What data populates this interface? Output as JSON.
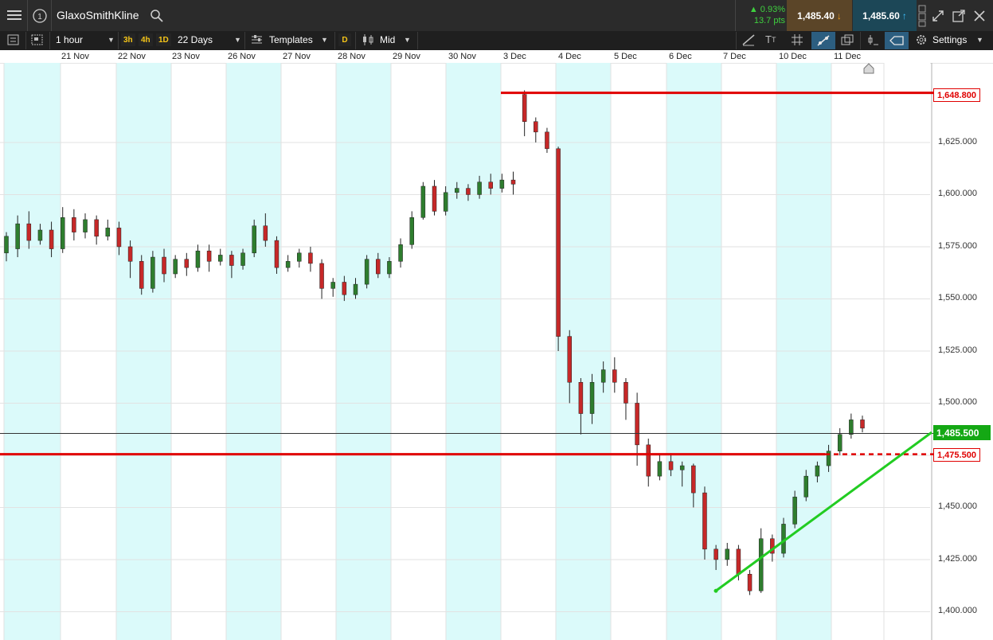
{
  "instrument": "GlaxoSmithKline",
  "change": {
    "percent": "0.93%",
    "points": "13.7 pts"
  },
  "prices": {
    "sell": "1,485.40",
    "buy": "1,485.60"
  },
  "toolbar": {
    "interval": "1 hour",
    "quick_intervals": [
      "3h",
      "4h",
      "1D"
    ],
    "range": "22 Days",
    "templates": "Templates",
    "d_badge": "D",
    "price_type": "Mid",
    "settings": "Settings"
  },
  "icons": [
    "menu-icon",
    "info-icon",
    "search-icon",
    "list-icon",
    "layout-icon",
    "templates-icon",
    "candle-type-icon",
    "draw-line-icon",
    "text-icon",
    "crosshair-icon",
    "trendline-icon",
    "windows-icon",
    "indicator-icon",
    "price-tag-icon",
    "gear-icon",
    "expand-icon",
    "popout-icon",
    "close-icon",
    "arrow-down-icon",
    "arrow-up-icon"
  ],
  "colors": {
    "up": "#2e7d2e",
    "down": "#c62828",
    "support_line": "#e00000",
    "trend_line": "#22cc22",
    "weekend_shade": "#dbfafa",
    "last_price_bg": "#14a814"
  },
  "date_labels": [
    "21 Nov",
    "22 Nov",
    "23 Nov",
    "26 Nov",
    "27 Nov",
    "28 Nov",
    "29 Nov",
    "30 Nov",
    "3 Dec",
    "4 Dec",
    "5 Dec",
    "6 Dec",
    "7 Dec",
    "10 Dec",
    "11 Dec"
  ],
  "y_ticks": [
    "1,625.000",
    "1,600.000",
    "1,575.000",
    "1,550.000",
    "1,525.000",
    "1,500.000",
    "1,450.000",
    "1,425.000",
    "1,400.000"
  ],
  "price_labels": {
    "resistance": "1,648.800",
    "last": "1,485.500",
    "support": "1,475.500"
  },
  "chart_data": {
    "type": "candlestick",
    "interval": "1 hour",
    "y_range": [
      1395,
      1665
    ],
    "levels": {
      "resistance": 1648.8,
      "last_price": 1485.5,
      "support": 1475.5
    },
    "trendline": {
      "from": {
        "date": "7 Dec",
        "price": 1410
      },
      "to": {
        "date": "11 Dec",
        "price": 1486
      }
    },
    "candles": [
      [
        1572,
        1580,
        1568,
        1582
      ],
      [
        1574,
        1586,
        1570,
        1590
      ],
      [
        1586,
        1578,
        1574,
        1592
      ],
      [
        1578,
        1583,
        1576,
        1586
      ],
      [
        1583,
        1574,
        1570,
        1587
      ],
      [
        1574,
        1589,
        1572,
        1594
      ],
      [
        1589,
        1582,
        1578,
        1593
      ],
      [
        1582,
        1588,
        1579,
        1591
      ],
      [
        1588,
        1580,
        1576,
        1590
      ],
      [
        1580,
        1584,
        1578,
        1588
      ],
      [
        1584,
        1575,
        1571,
        1587
      ],
      [
        1575,
        1568,
        1560,
        1578
      ],
      [
        1568,
        1555,
        1552,
        1571
      ],
      [
        1555,
        1570,
        1553,
        1573
      ],
      [
        1570,
        1562,
        1558,
        1574
      ],
      [
        1562,
        1569,
        1560,
        1571
      ],
      [
        1569,
        1565,
        1561,
        1572
      ],
      [
        1565,
        1573,
        1563,
        1576
      ],
      [
        1573,
        1568,
        1563,
        1576
      ],
      [
        1568,
        1571,
        1566,
        1574
      ],
      [
        1571,
        1566,
        1560,
        1573
      ],
      [
        1566,
        1572,
        1564,
        1574
      ],
      [
        1572,
        1585,
        1570,
        1588
      ],
      [
        1585,
        1578,
        1575,
        1591
      ],
      [
        1578,
        1565,
        1562,
        1580
      ],
      [
        1565,
        1568,
        1563,
        1571
      ],
      [
        1568,
        1572,
        1565,
        1574
      ],
      [
        1572,
        1567,
        1563,
        1575
      ],
      [
        1567,
        1555,
        1550,
        1569
      ],
      [
        1555,
        1558,
        1551,
        1560
      ],
      [
        1558,
        1552,
        1549,
        1561
      ],
      [
        1552,
        1557,
        1550,
        1560
      ],
      [
        1557,
        1569,
        1555,
        1571
      ],
      [
        1569,
        1562,
        1560,
        1572
      ],
      [
        1562,
        1568,
        1560,
        1570
      ],
      [
        1568,
        1576,
        1565,
        1579
      ],
      [
        1576,
        1589,
        1574,
        1592
      ],
      [
        1589,
        1604,
        1588,
        1606
      ],
      [
        1604,
        1592,
        1590,
        1607
      ],
      [
        1592,
        1601,
        1590,
        1604
      ],
      [
        1601,
        1603,
        1598,
        1606
      ],
      [
        1603,
        1600,
        1597,
        1605
      ],
      [
        1600,
        1606,
        1598,
        1609
      ],
      [
        1606,
        1603,
        1600,
        1610
      ],
      [
        1603,
        1607,
        1601,
        1610
      ],
      [
        1607,
        1605,
        1600,
        1611
      ],
      [
        1648,
        1635,
        1628,
        1650
      ],
      [
        1635,
        1630,
        1625,
        1637
      ],
      [
        1630,
        1622,
        1620,
        1632
      ],
      [
        1622,
        1532,
        1525,
        1623
      ],
      [
        1532,
        1510,
        1500,
        1535
      ],
      [
        1510,
        1495,
        1485,
        1512
      ],
      [
        1495,
        1510,
        1490,
        1514
      ],
      [
        1510,
        1516,
        1505,
        1520
      ],
      [
        1516,
        1510,
        1505,
        1522
      ],
      [
        1510,
        1500,
        1492,
        1512
      ],
      [
        1500,
        1480,
        1470,
        1505
      ],
      [
        1480,
        1465,
        1460,
        1483
      ],
      [
        1465,
        1472,
        1463,
        1475
      ],
      [
        1472,
        1468,
        1465,
        1476
      ],
      [
        1468,
        1470,
        1460,
        1472
      ],
      [
        1470,
        1457,
        1450,
        1471
      ],
      [
        1457,
        1430,
        1425,
        1460
      ],
      [
        1430,
        1425,
        1420,
        1432
      ],
      [
        1425,
        1430,
        1422,
        1433
      ],
      [
        1430,
        1418,
        1415,
        1432
      ],
      [
        1418,
        1410,
        1408,
        1420
      ],
      [
        1410,
        1435,
        1409,
        1440
      ],
      [
        1435,
        1428,
        1424,
        1437
      ],
      [
        1428,
        1442,
        1426,
        1445
      ],
      [
        1442,
        1455,
        1440,
        1458
      ],
      [
        1455,
        1465,
        1453,
        1468
      ],
      [
        1465,
        1470,
        1462,
        1472
      ],
      [
        1470,
        1477,
        1467,
        1480
      ],
      [
        1477,
        1485,
        1475,
        1488
      ],
      [
        1485,
        1492,
        1483,
        1495
      ],
      [
        1492,
        1488,
        1486,
        1494
      ]
    ]
  }
}
